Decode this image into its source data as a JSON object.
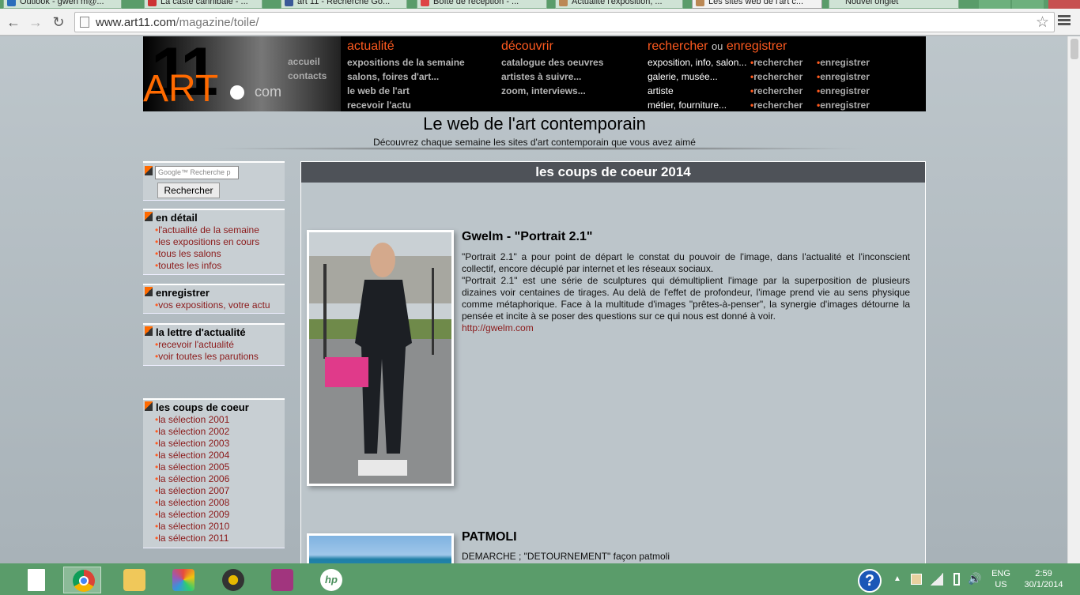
{
  "browser": {
    "tabs": [
      {
        "label": "Outlook - gwen m@..."
      },
      {
        "label": "La caste cannibale - ..."
      },
      {
        "label": "art 11 - Recherche Go..."
      },
      {
        "label": "Boîte de réception - ..."
      },
      {
        "label": "Actualité l'exposition, ..."
      },
      {
        "label": "Les sites web de l'art c...",
        "active": true
      },
      {
        "label": "Nouvel onglet"
      }
    ],
    "url_host": "www.art11.com",
    "url_path": "/magazine/toile/"
  },
  "header": {
    "logo_11": "11",
    "logo_art": "ART",
    "logo_com": "com",
    "small_links": [
      "accueil",
      "contacts"
    ],
    "actualite": {
      "title": "actualité",
      "links": [
        "expositions de la semaine",
        "salons, foires d'art...",
        "le web de l'art",
        "recevoir l'actu"
      ]
    },
    "decouvrir": {
      "title": "découvrir",
      "links": [
        "catalogue des oeuvres",
        "artistes à suivre...",
        "zoom, interviews..."
      ]
    },
    "rechercher": {
      "title_a": "rechercher",
      "title_ou": "ou",
      "title_b": "enregistrer",
      "categories": [
        "exposition, info, salon...",
        "galerie, musée...",
        "artiste",
        "métier, fourniture..."
      ],
      "search_label": "rechercher",
      "register_label": "enregistrer"
    }
  },
  "tagline": {
    "title": "Le web de l'art contemporain",
    "subtitle": "Découvrez chaque semaine les sites d'art contemporain que vous avez aimé"
  },
  "sidebar": {
    "search": {
      "placeholder": "Google™ Recherche p",
      "button": "Rechercher"
    },
    "en_detail": {
      "title": "en détail",
      "links": [
        "l'actualité de la semaine",
        "les expositions en cours",
        "tous les salons",
        "toutes les infos"
      ]
    },
    "enregistrer": {
      "title": "enregistrer",
      "links": [
        "vos expositions, votre actu"
      ]
    },
    "lettre": {
      "title": "la lettre d'actualité",
      "links": [
        "recevoir l'actualité",
        "voir toutes les parutions"
      ]
    },
    "coups": {
      "title": "les coups de coeur",
      "links": [
        "la sélection 2001",
        "la sélection 2002",
        "la sélection 2003",
        "la sélection 2004",
        "la sélection 2005",
        "la sélection 2006",
        "la sélection 2007",
        "la sélection 2008",
        "la sélection 2009",
        "la sélection 2010",
        "la sélection 2011"
      ]
    }
  },
  "main": {
    "heading": "les coups de coeur 2014",
    "articles": [
      {
        "title": "Gwelm - \"Portrait 2.1\"",
        "p1": "\"Portrait 2.1\" a pour point de départ le constat du pouvoir de l'image, dans l'actualité et l'inconscient collectif, encore décuplé par internet et les réseaux sociaux.",
        "p2": "\"Portrait 2.1\" est une série de sculptures qui démultiplient l'image par la superposition de plusieurs dizaines voir centaines de tirages. Au delà de l'effet de profondeur, l'image prend vie au sens physique comme métaphorique.  Face à la multitude d'images \"prêtes-à-penser\", la synergie d'images détourne la pensée et incite à se poser des questions sur ce qui nous est donné à voir.",
        "link": "http://gwelm.com"
      },
      {
        "title": "PATMOLI",
        "p1": "DEMARCHE ; \"DETOURNEMENT\" façon patmoli"
      }
    ]
  },
  "taskbar": {
    "lang_top": "ENG",
    "lang_bottom": "US",
    "time": "2:59",
    "date": "30/1/2014"
  }
}
